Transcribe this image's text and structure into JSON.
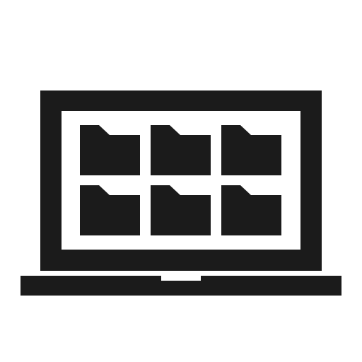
{
  "icon": {
    "name": "laptop-folders-icon",
    "color": "#1b1b1b",
    "background": "#ffffff",
    "folders": [
      {
        "name": "folder-icon"
      },
      {
        "name": "folder-icon"
      },
      {
        "name": "folder-icon"
      },
      {
        "name": "folder-icon"
      },
      {
        "name": "folder-icon"
      },
      {
        "name": "folder-icon"
      }
    ]
  }
}
